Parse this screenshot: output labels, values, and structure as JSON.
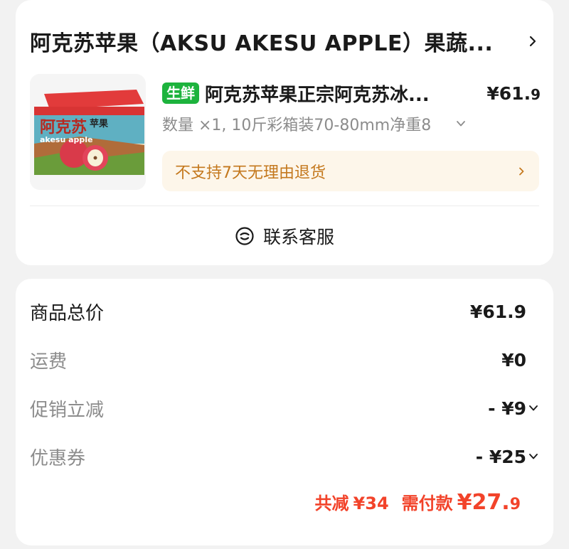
{
  "order": {
    "shop_name": "阿克苏苹果（AKSU AKESU APPLE）果蔬...",
    "product": {
      "badge": "生鲜",
      "title": "阿克苏苹果正宗阿克苏冰...",
      "price_main": "¥61.",
      "price_cents": "9",
      "spec": "数量 ×1, 10斤彩箱装70-80mm净重8",
      "image_text": {
        "brand": "阿克苏",
        "product": "苹果",
        "english": "akesu apple"
      }
    },
    "return_note": "不支持7天无理由退货",
    "contact_label": "联系客服"
  },
  "price": {
    "rows": [
      {
        "label": "商品总价",
        "value": "¥61.9"
      },
      {
        "label": "运费",
        "value": "¥0"
      },
      {
        "label": "促销立减",
        "value": "- ¥9"
      },
      {
        "label": "优惠券",
        "value": "- ¥25"
      }
    ],
    "summary": {
      "saved_label": "共减",
      "saved_amount": "¥34",
      "pay_label": "需付款",
      "pay_main": "¥27.",
      "pay_cents": "9"
    }
  },
  "colors": {
    "accent_red": "#f2432a",
    "fresh_green": "#1db33d",
    "return_text": "#c4781d",
    "return_bg": "#fdf6ea"
  }
}
